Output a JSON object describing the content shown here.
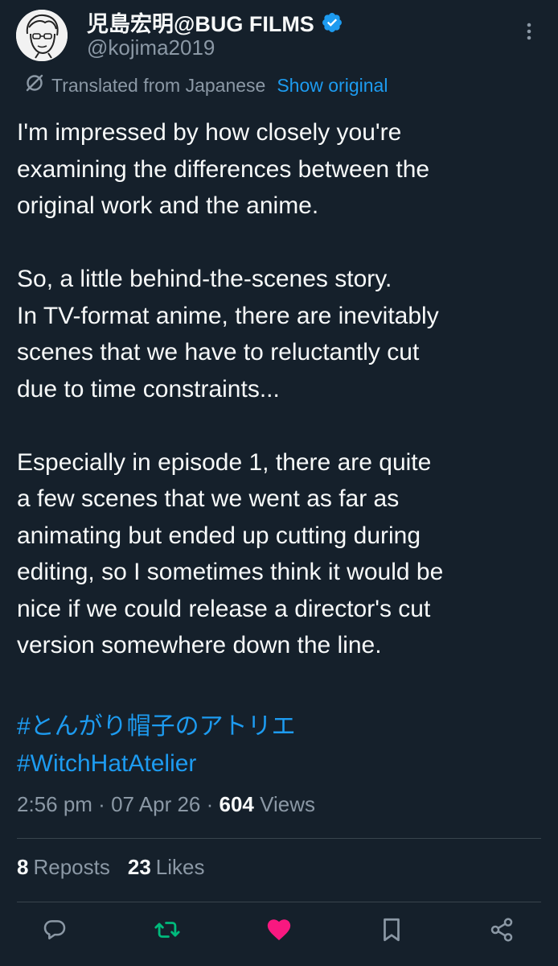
{
  "author": {
    "display_name": "児島宏明@BUG FILMS",
    "handle": "@kojima2019",
    "verified": true,
    "avatar_icon": "avatar-illustration"
  },
  "translation": {
    "label": "Translated from Japanese",
    "show_original": "Show original"
  },
  "tweet": {
    "paragraphs": [
      [
        "I'm impressed by how closely you're",
        "examining the differences between the",
        "original work and the anime."
      ],
      [
        "So, a little behind-the-scenes story.",
        "In TV-format anime, there are inevitably",
        "scenes that we have to reluctantly cut",
        "due to time constraints..."
      ],
      [
        "Especially in episode 1, there are quite",
        "a few scenes that we went as far as",
        "animating but ended up cutting during",
        "editing, so I sometimes think it would be",
        "nice if we could release a director's cut",
        "version somewhere down the line."
      ]
    ],
    "hashtags": [
      "#とんがり帽子のアトリエ",
      "#WitchHatAtelier"
    ]
  },
  "meta": {
    "time": "2:56 pm",
    "date": "07 Apr 26",
    "separator": " · ",
    "views_count": "604",
    "views_label": "Views"
  },
  "stats": {
    "reposts_count": "8",
    "reposts_label": "Reposts",
    "likes_count": "23",
    "likes_label": "Likes"
  },
  "actions": {
    "reply_icon": "reply-icon",
    "repost_icon": "repost-icon",
    "like_icon": "heart-icon",
    "bookmark_icon": "bookmark-icon",
    "share_icon": "share-icon"
  },
  "colors": {
    "background": "#15202b",
    "text": "#f7f9f9",
    "secondary": "#8b98a5",
    "link": "#1d9bf0",
    "repost_active": "#00ba7c",
    "like_active": "#f91880"
  }
}
